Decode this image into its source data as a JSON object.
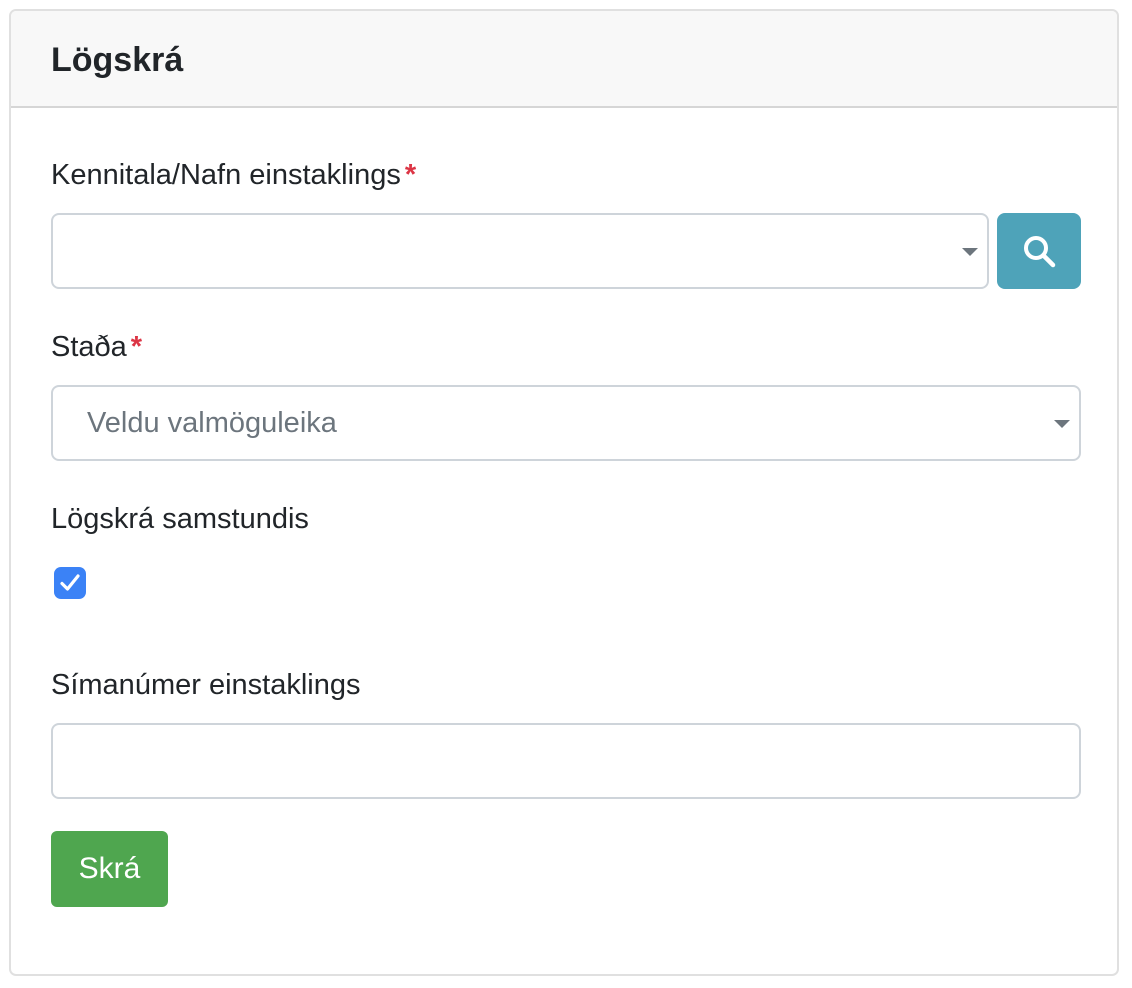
{
  "card": {
    "title": "Lögskrá"
  },
  "form": {
    "person_label": "Kennitala/Nafn einstaklings",
    "person_required": "*",
    "person_value": "",
    "status_label": "Staða",
    "status_required": "*",
    "status_placeholder": "Veldu valmöguleika",
    "register_together_label": "Lögskrá samstundis",
    "register_together_checked": true,
    "phone_label": "Símanúmer einstaklings",
    "phone_value": "",
    "submit_label": "Skrá"
  },
  "icons": {
    "search": "search-icon",
    "dropdown": "caret-down-icon",
    "check": "check-icon"
  },
  "colors": {
    "search_button": "#4ea3b9",
    "submit_button": "#4fa64f",
    "checkbox": "#3b82f6",
    "required": "#dc3545"
  }
}
